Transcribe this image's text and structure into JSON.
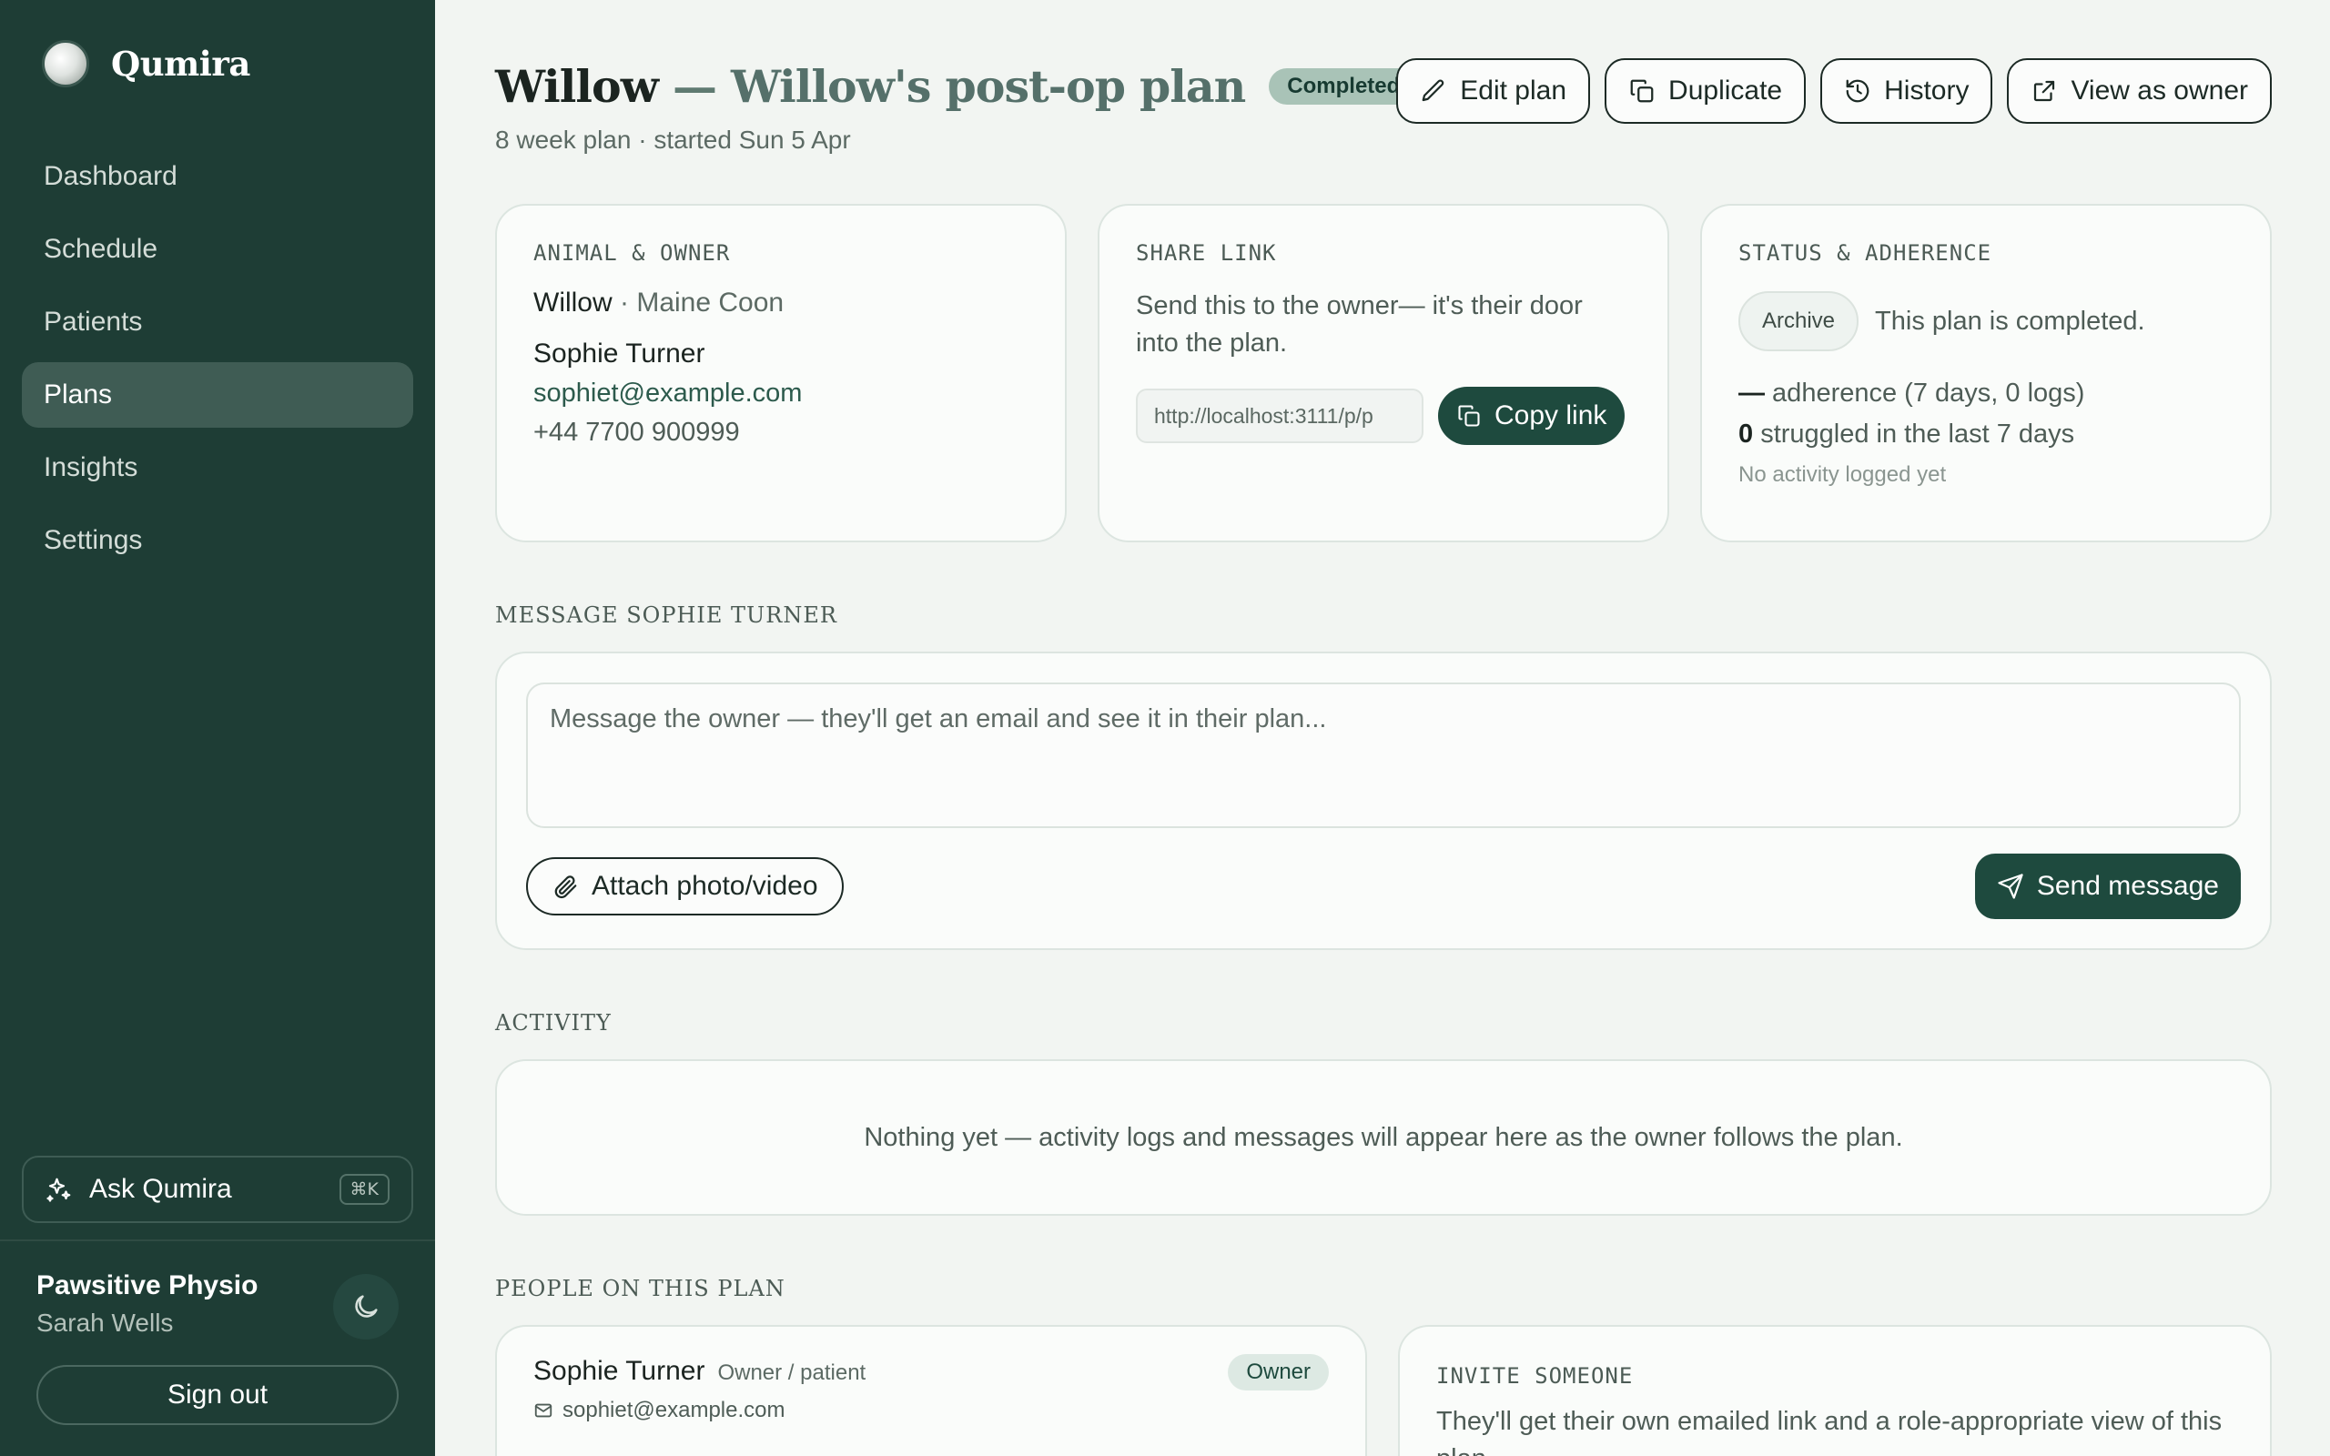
{
  "app": {
    "name": "Qumira"
  },
  "sidebar": {
    "items": [
      {
        "label": "Dashboard",
        "active": false
      },
      {
        "label": "Schedule",
        "active": false
      },
      {
        "label": "Patients",
        "active": false
      },
      {
        "label": "Plans",
        "active": true
      },
      {
        "label": "Insights",
        "active": false
      },
      {
        "label": "Settings",
        "active": false
      }
    ],
    "ask": {
      "label": "Ask Qumira",
      "shortcut": "⌘K"
    },
    "org": {
      "name": "Pawsitive Physio",
      "user": "Sarah Wells"
    },
    "signout_label": "Sign out"
  },
  "header": {
    "pet_name": "Willow",
    "separator": "—",
    "plan_name": "Willow's post-op plan",
    "status_badge": "Completed",
    "subtitle": "8 week plan · started Sun 5 Apr",
    "actions": {
      "edit": "Edit plan",
      "duplicate": "Duplicate",
      "history": "History",
      "view_owner": "View as owner"
    }
  },
  "animal_owner": {
    "label": "ANIMAL & OWNER",
    "pet_name": "Willow",
    "breed": " · Maine Coon",
    "owner_name": "Sophie Turner",
    "owner_email": "sophiet@example.com",
    "owner_phone": "+44 7700 900999"
  },
  "share_link": {
    "label": "SHARE LINK",
    "description": "Send this to the owner— it's their door into the plan.",
    "url": "http://localhost:3111/p/p",
    "copy_label": "Copy link"
  },
  "status": {
    "label": "STATUS & ADHERENCE",
    "archive_label": "Archive",
    "status_text": "This plan is completed.",
    "adherence_value": "—",
    "adherence_text": " adherence (7 days, 0 logs)",
    "struggled_value": "0",
    "struggled_text": " struggled in the last 7 days",
    "no_activity": "No activity logged yet"
  },
  "message": {
    "section_label": "MESSAGE SOPHIE TURNER",
    "placeholder": "Message the owner — they'll get an email and see it in their plan...",
    "attach_label": "Attach photo/video",
    "send_label": "Send message"
  },
  "activity": {
    "section_label": "ACTIVITY",
    "empty_text": "Nothing yet — activity logs and messages will appear here as the owner follows the plan."
  },
  "people": {
    "section_label": "PEOPLE ON THIS PLAN",
    "person": {
      "name": "Sophie Turner",
      "role": "Owner / patient",
      "badge": "Owner",
      "email": "sophiet@example.com"
    },
    "invite": {
      "label": "INVITE SOMEONE",
      "text": "They'll get their own emailed link and a role-appropriate view of this plan."
    }
  },
  "colors": {
    "sidebar_bg": "#1e3d35",
    "accent": "#1e4a3e",
    "badge_completed": "#a9c3b7",
    "page_bg": "#f2f5f2"
  }
}
